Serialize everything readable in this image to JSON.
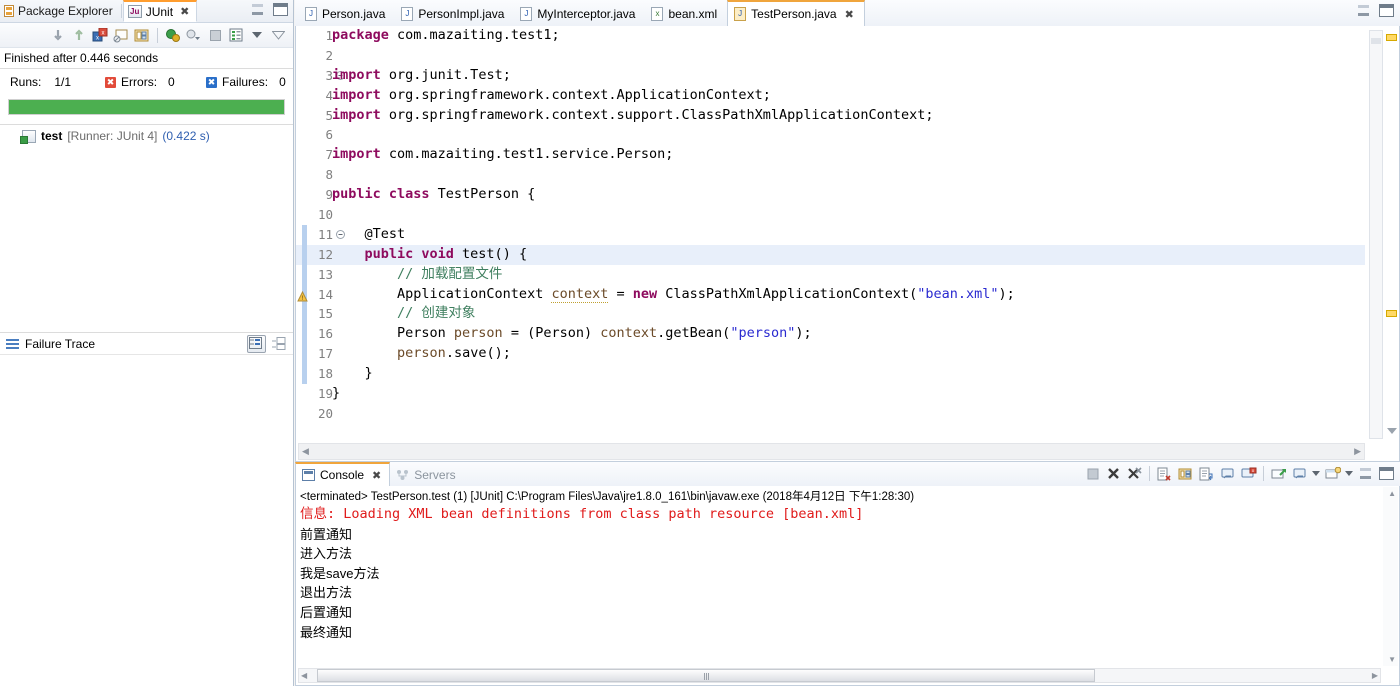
{
  "left_panel": {
    "tabs": [
      {
        "label": "Package Explorer",
        "icon": "package-explorer-icon",
        "active": false
      },
      {
        "label": "JUnit",
        "icon": "junit-icon",
        "active": true,
        "closeable": true
      }
    ],
    "window_buttons": [
      "minimize",
      "maximize"
    ],
    "toolbar_icons": [
      "next-failure-icon",
      "previous-failure-icon",
      "show-failures-only-icon",
      "scroll-lock-icon",
      "show-test-hierarchy-icon",
      "rerun-test-icon",
      "rerun-test-failures-icon",
      "stop-icon",
      "test-run-history-icon",
      "view-menu-icon",
      "minimize-view-icon"
    ],
    "status_text": "Finished after 0.446 seconds",
    "counters": [
      {
        "label": "Runs:",
        "value": "1/1",
        "badge": "none"
      },
      {
        "label": "Errors:",
        "value": "0",
        "badge": "red"
      },
      {
        "label": "Failures:",
        "value": "0",
        "badge": "blue"
      }
    ],
    "progress": {
      "percent": 100,
      "color": "#4caf50"
    },
    "tree": [
      {
        "name": "test",
        "runner": "[Runner: JUnit 4]",
        "time": "(0.422 s)",
        "icon": "test-pass-icon"
      }
    ],
    "failure_trace": {
      "title": "Failure Trace",
      "icon": "failure-trace-icon",
      "buttons": [
        "compare-result-icon",
        "maximize-trace-icon"
      ],
      "content": ""
    }
  },
  "editor": {
    "tabs": [
      {
        "label": "Person.java",
        "icon": "java-file-icon",
        "active": false
      },
      {
        "label": "PersonImpl.java",
        "icon": "java-file-icon",
        "active": false
      },
      {
        "label": "MyInterceptor.java",
        "icon": "java-file-icon",
        "active": false
      },
      {
        "label": "bean.xml",
        "icon": "xml-file-icon",
        "active": false
      },
      {
        "label": "TestPerson.java",
        "icon": "java-file-locked-icon",
        "active": true,
        "closeable": true
      }
    ],
    "window_buttons": [
      "minimize",
      "maximize"
    ],
    "lines": [
      {
        "n": "1",
        "fold": "",
        "changed": false,
        "hl": false,
        "annot": "",
        "tokens": [
          {
            "t": "package",
            "c": "kw"
          },
          {
            "t": " com.mazaiting.test1;",
            "c": "plain"
          }
        ]
      },
      {
        "n": "2",
        "fold": "",
        "changed": false,
        "hl": false,
        "annot": "",
        "tokens": []
      },
      {
        "n": "3",
        "fold": "minus",
        "changed": false,
        "hl": false,
        "annot": "",
        "tokens": [
          {
            "t": "import",
            "c": "kw"
          },
          {
            "t": " org.junit.Test;",
            "c": "plain"
          }
        ]
      },
      {
        "n": "4",
        "fold": "",
        "changed": false,
        "hl": false,
        "annot": "",
        "tokens": [
          {
            "t": "import",
            "c": "kw"
          },
          {
            "t": " org.springframework.context.ApplicationContext;",
            "c": "plain"
          }
        ]
      },
      {
        "n": "5",
        "fold": "",
        "changed": false,
        "hl": false,
        "annot": "",
        "tokens": [
          {
            "t": "import",
            "c": "kw"
          },
          {
            "t": " org.springframework.context.support.ClassPathXmlApplicationContext;",
            "c": "plain"
          }
        ]
      },
      {
        "n": "6",
        "fold": "",
        "changed": false,
        "hl": false,
        "annot": "",
        "tokens": []
      },
      {
        "n": "7",
        "fold": "",
        "changed": false,
        "hl": false,
        "annot": "",
        "tokens": [
          {
            "t": "import",
            "c": "kw"
          },
          {
            "t": " com.mazaiting.test1.service.Person;",
            "c": "plain"
          }
        ]
      },
      {
        "n": "8",
        "fold": "",
        "changed": false,
        "hl": false,
        "annot": "",
        "tokens": []
      },
      {
        "n": "9",
        "fold": "",
        "changed": false,
        "hl": false,
        "annot": "",
        "tokens": [
          {
            "t": "public class",
            "c": "kw"
          },
          {
            "t": " TestPerson {",
            "c": "plain"
          }
        ]
      },
      {
        "n": "10",
        "fold": "",
        "changed": false,
        "hl": false,
        "annot": "",
        "tokens": []
      },
      {
        "n": "11",
        "fold": "minus",
        "changed": true,
        "hl": false,
        "annot": "",
        "tokens": [
          {
            "t": "    @Test",
            "c": "plain"
          }
        ]
      },
      {
        "n": "12",
        "fold": "",
        "changed": true,
        "hl": true,
        "annot": "",
        "tokens": [
          {
            "t": "    ",
            "c": "plain"
          },
          {
            "t": "public void",
            "c": "kw"
          },
          {
            "t": " test() {",
            "c": "plain"
          }
        ]
      },
      {
        "n": "13",
        "fold": "",
        "changed": true,
        "hl": false,
        "annot": "",
        "tokens": [
          {
            "t": "        // 加载配置文件",
            "c": "cmt"
          }
        ]
      },
      {
        "n": "14",
        "fold": "",
        "changed": true,
        "hl": false,
        "annot": "warning",
        "tokens": [
          {
            "t": "        ApplicationContext ",
            "c": "plain"
          },
          {
            "t": "context",
            "c": "loc-u"
          },
          {
            "t": " = ",
            "c": "plain"
          },
          {
            "t": "new",
            "c": "kw"
          },
          {
            "t": " ClassPathXmlApplicationContext(",
            "c": "plain"
          },
          {
            "t": "\"bean.xml\"",
            "c": "str"
          },
          {
            "t": ");",
            "c": "plain"
          }
        ]
      },
      {
        "n": "15",
        "fold": "",
        "changed": true,
        "hl": false,
        "annot": "",
        "tokens": [
          {
            "t": "        // 创建对象",
            "c": "cmt"
          }
        ]
      },
      {
        "n": "16",
        "fold": "",
        "changed": true,
        "hl": false,
        "annot": "",
        "tokens": [
          {
            "t": "        Person ",
            "c": "plain"
          },
          {
            "t": "person",
            "c": "loc"
          },
          {
            "t": " = (Person) ",
            "c": "plain"
          },
          {
            "t": "context",
            "c": "loc"
          },
          {
            "t": ".getBean(",
            "c": "plain"
          },
          {
            "t": "\"person\"",
            "c": "str"
          },
          {
            "t": ");",
            "c": "plain"
          }
        ]
      },
      {
        "n": "17",
        "fold": "",
        "changed": true,
        "hl": false,
        "annot": "",
        "tokens": [
          {
            "t": "        ",
            "c": "plain"
          },
          {
            "t": "person",
            "c": "loc"
          },
          {
            "t": ".save();",
            "c": "plain"
          }
        ]
      },
      {
        "n": "18",
        "fold": "",
        "changed": true,
        "hl": false,
        "annot": "",
        "tokens": [
          {
            "t": "    }",
            "c": "plain"
          }
        ]
      },
      {
        "n": "19",
        "fold": "",
        "changed": false,
        "hl": false,
        "annot": "",
        "tokens": [
          {
            "t": "}",
            "c": "plain"
          }
        ]
      },
      {
        "n": "20",
        "fold": "",
        "changed": false,
        "hl": false,
        "annot": "",
        "tokens": []
      }
    ],
    "ruler_markers": [
      {
        "name": "warning-marker-top",
        "top_pct": 2
      },
      {
        "name": "warning-marker-mid",
        "top_pct": 64
      }
    ]
  },
  "console": {
    "tabs": [
      {
        "label": "Console",
        "icon": "console-icon",
        "active": true,
        "closeable": true
      },
      {
        "label": "Servers",
        "icon": "servers-icon",
        "active": false
      }
    ],
    "toolbar_icons": [
      "terminate-icon",
      "remove-launch-icon",
      "remove-all-terminated-icon",
      "clear-console-icon",
      "scroll-lock-icon",
      "word-wrap-icon",
      "show-console-on-output-icon",
      "pin-console-icon",
      "display-selected-console-icon",
      "open-console-icon",
      "minimize-icon",
      "maximize-icon"
    ],
    "terminated_line": "<terminated> TestPerson.test (1) [JUnit] C:\\Program Files\\Java\\jre1.8.0_161\\bin\\javaw.exe (2018年4月12日 下午1:28:30)",
    "output": [
      {
        "text": "信息: Loading XML bean definitions from class path resource [bean.xml]",
        "style": "err"
      },
      {
        "text": "前置通知",
        "style": "cn"
      },
      {
        "text": "进入方法",
        "style": "cn"
      },
      {
        "text": "我是save方法",
        "style": "cn"
      },
      {
        "text": "退出方法",
        "style": "cn"
      },
      {
        "text": "后置通知",
        "style": "cn"
      },
      {
        "text": "最终通知",
        "style": "cn"
      }
    ]
  },
  "colors": {
    "keyword": "#8e0b5e",
    "string": "#2a2ad0",
    "comment": "#3f7f5f",
    "local_var": "#6b4a28",
    "error_text": "#e01b1b",
    "progress_green": "#4caf50",
    "active_tab_accent": "#f0a53c",
    "highlight_line": "#e8effa"
  }
}
